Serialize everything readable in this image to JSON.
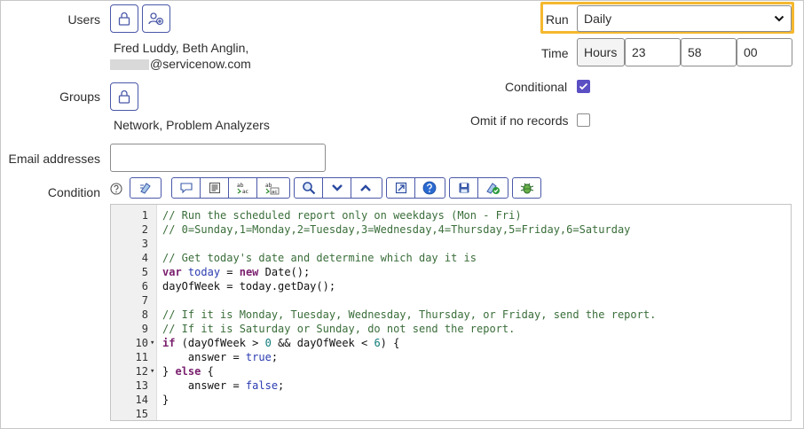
{
  "users": {
    "label": "Users",
    "value_line1": "Fred Luddy, Beth Anglin,",
    "value_line2_suffix": "@servicenow.com",
    "lock_icon": "lock-icon",
    "add_user_icon": "add-user-icon"
  },
  "groups": {
    "label": "Groups",
    "value": "Network, Problem Analyzers",
    "lock_icon": "lock-icon"
  },
  "email": {
    "label": "Email addresses",
    "value": ""
  },
  "condition": {
    "label": "Condition",
    "help_icon": "help-icon"
  },
  "run": {
    "label": "Run",
    "selected": "Daily",
    "highlight_color": "#f5b82e"
  },
  "time": {
    "label": "Time",
    "unit": "Hours",
    "hours": "23",
    "minutes": "58",
    "seconds": "00"
  },
  "conditional": {
    "label": "Conditional",
    "checked": true
  },
  "omit": {
    "label": "Omit if no records",
    "checked": false
  },
  "toolbar": {
    "icons": [
      "toggle-syntax-icon",
      "comment-icon",
      "format-icon",
      "replace-icon",
      "replace-all-icon",
      "search-icon",
      "next-icon",
      "previous-icon",
      "fullscreen-icon",
      "help-icon",
      "save-icon",
      "check-syntax-icon",
      "debug-icon"
    ]
  },
  "editor": {
    "lines": [
      {
        "n": "1",
        "fold": "",
        "code": "// Run the scheduled report only on weekdays (Mon - Fri)"
      },
      {
        "n": "2",
        "fold": "",
        "code": "// 0=Sunday,1=Monday,2=Tuesday,3=Wednesday,4=Thursday,5=Friday,6=Saturday"
      },
      {
        "n": "3",
        "fold": "",
        "code": ""
      },
      {
        "n": "4",
        "fold": "",
        "code": "// Get today's date and determine which day it is"
      },
      {
        "n": "5",
        "fold": "",
        "code": "var today = new Date();"
      },
      {
        "n": "6",
        "fold": "",
        "code": "dayOfWeek = today.getDay();"
      },
      {
        "n": "7",
        "fold": "",
        "code": ""
      },
      {
        "n": "8",
        "fold": "",
        "code": "// If it is Monday, Tuesday, Wednesday, Thursday, or Friday, send the report."
      },
      {
        "n": "9",
        "fold": "",
        "code": "// If it is Saturday or Sunday, do not send the report."
      },
      {
        "n": "10",
        "fold": "▾",
        "code": "if (dayOfWeek > 0 && dayOfWeek < 6) {"
      },
      {
        "n": "11",
        "fold": "",
        "code": "    answer = true;"
      },
      {
        "n": "12",
        "fold": "▾",
        "code": "} else {"
      },
      {
        "n": "13",
        "fold": "",
        "code": "    answer = false;"
      },
      {
        "n": "14",
        "fold": "",
        "code": "}"
      },
      {
        "n": "15",
        "fold": "",
        "code": ""
      }
    ]
  }
}
